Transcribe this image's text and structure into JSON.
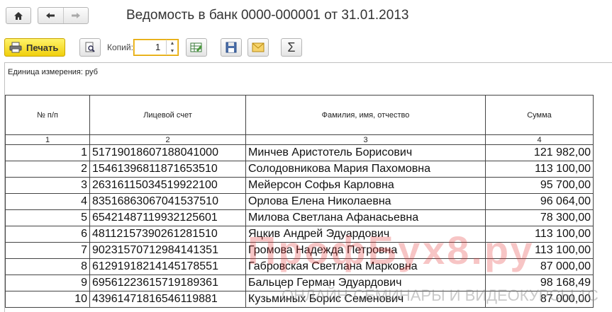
{
  "window": {
    "title": "Ведомость в банк 0000-000001 от 31.01.2013"
  },
  "toolbar": {
    "print_label": "Печать",
    "copies_label": "Копий:",
    "copies_value": "1",
    "sum_glyph": "Σ"
  },
  "document": {
    "unit_text": "Единица измерения: руб",
    "headers": [
      "№ п/п",
      "Лицевой счет",
      "Фамилия, имя, отчество",
      "Сумма"
    ],
    "col_numbers": [
      "1",
      "2",
      "3",
      "4"
    ],
    "rows": [
      {
        "n": "1",
        "account": "51719018607188041000",
        "name": "Минчев Аристотель Борисович",
        "sum": "121 982,00"
      },
      {
        "n": "2",
        "account": "15461396811871653510",
        "name": "Солодовникова Мария Пахомовна",
        "sum": "113 100,00"
      },
      {
        "n": "3",
        "account": "26316115034519922100",
        "name": "Мейерсон Софья Карловна",
        "sum": "95 700,00"
      },
      {
        "n": "4",
        "account": "83516863067041537510",
        "name": "Орлова Елена Николаевна",
        "sum": "96 064,00"
      },
      {
        "n": "5",
        "account": "65421487119932125601",
        "name": "Милова Светлана Афанасьевна",
        "sum": "78 300,00"
      },
      {
        "n": "6",
        "account": "48112157390261281510",
        "name": "Яцкив Андрей Эдуардович",
        "sum": "113 100,00"
      },
      {
        "n": "7",
        "account": "90231570712984141351",
        "name": "Громова Надежда Петровна",
        "sum": "113 100,00"
      },
      {
        "n": "8",
        "account": "61291918214145178551",
        "name": "Габровская Светлана Марковна",
        "sum": "87 000,00"
      },
      {
        "n": "9",
        "account": "69561223615719189361",
        "name": "Бальцер Герман Эдуардович",
        "sum": "98 168,49"
      },
      {
        "n": "10",
        "account": "43961471816546119881",
        "name": "Кузьминых Борис Семенович",
        "sum": "87 000,00"
      }
    ],
    "watermark": "ПрофБух8.ру",
    "watermark_sub": "ОНЛАЙН-СЕМИНАРЫ И ВИДЕОКУРСЫ 1С"
  }
}
